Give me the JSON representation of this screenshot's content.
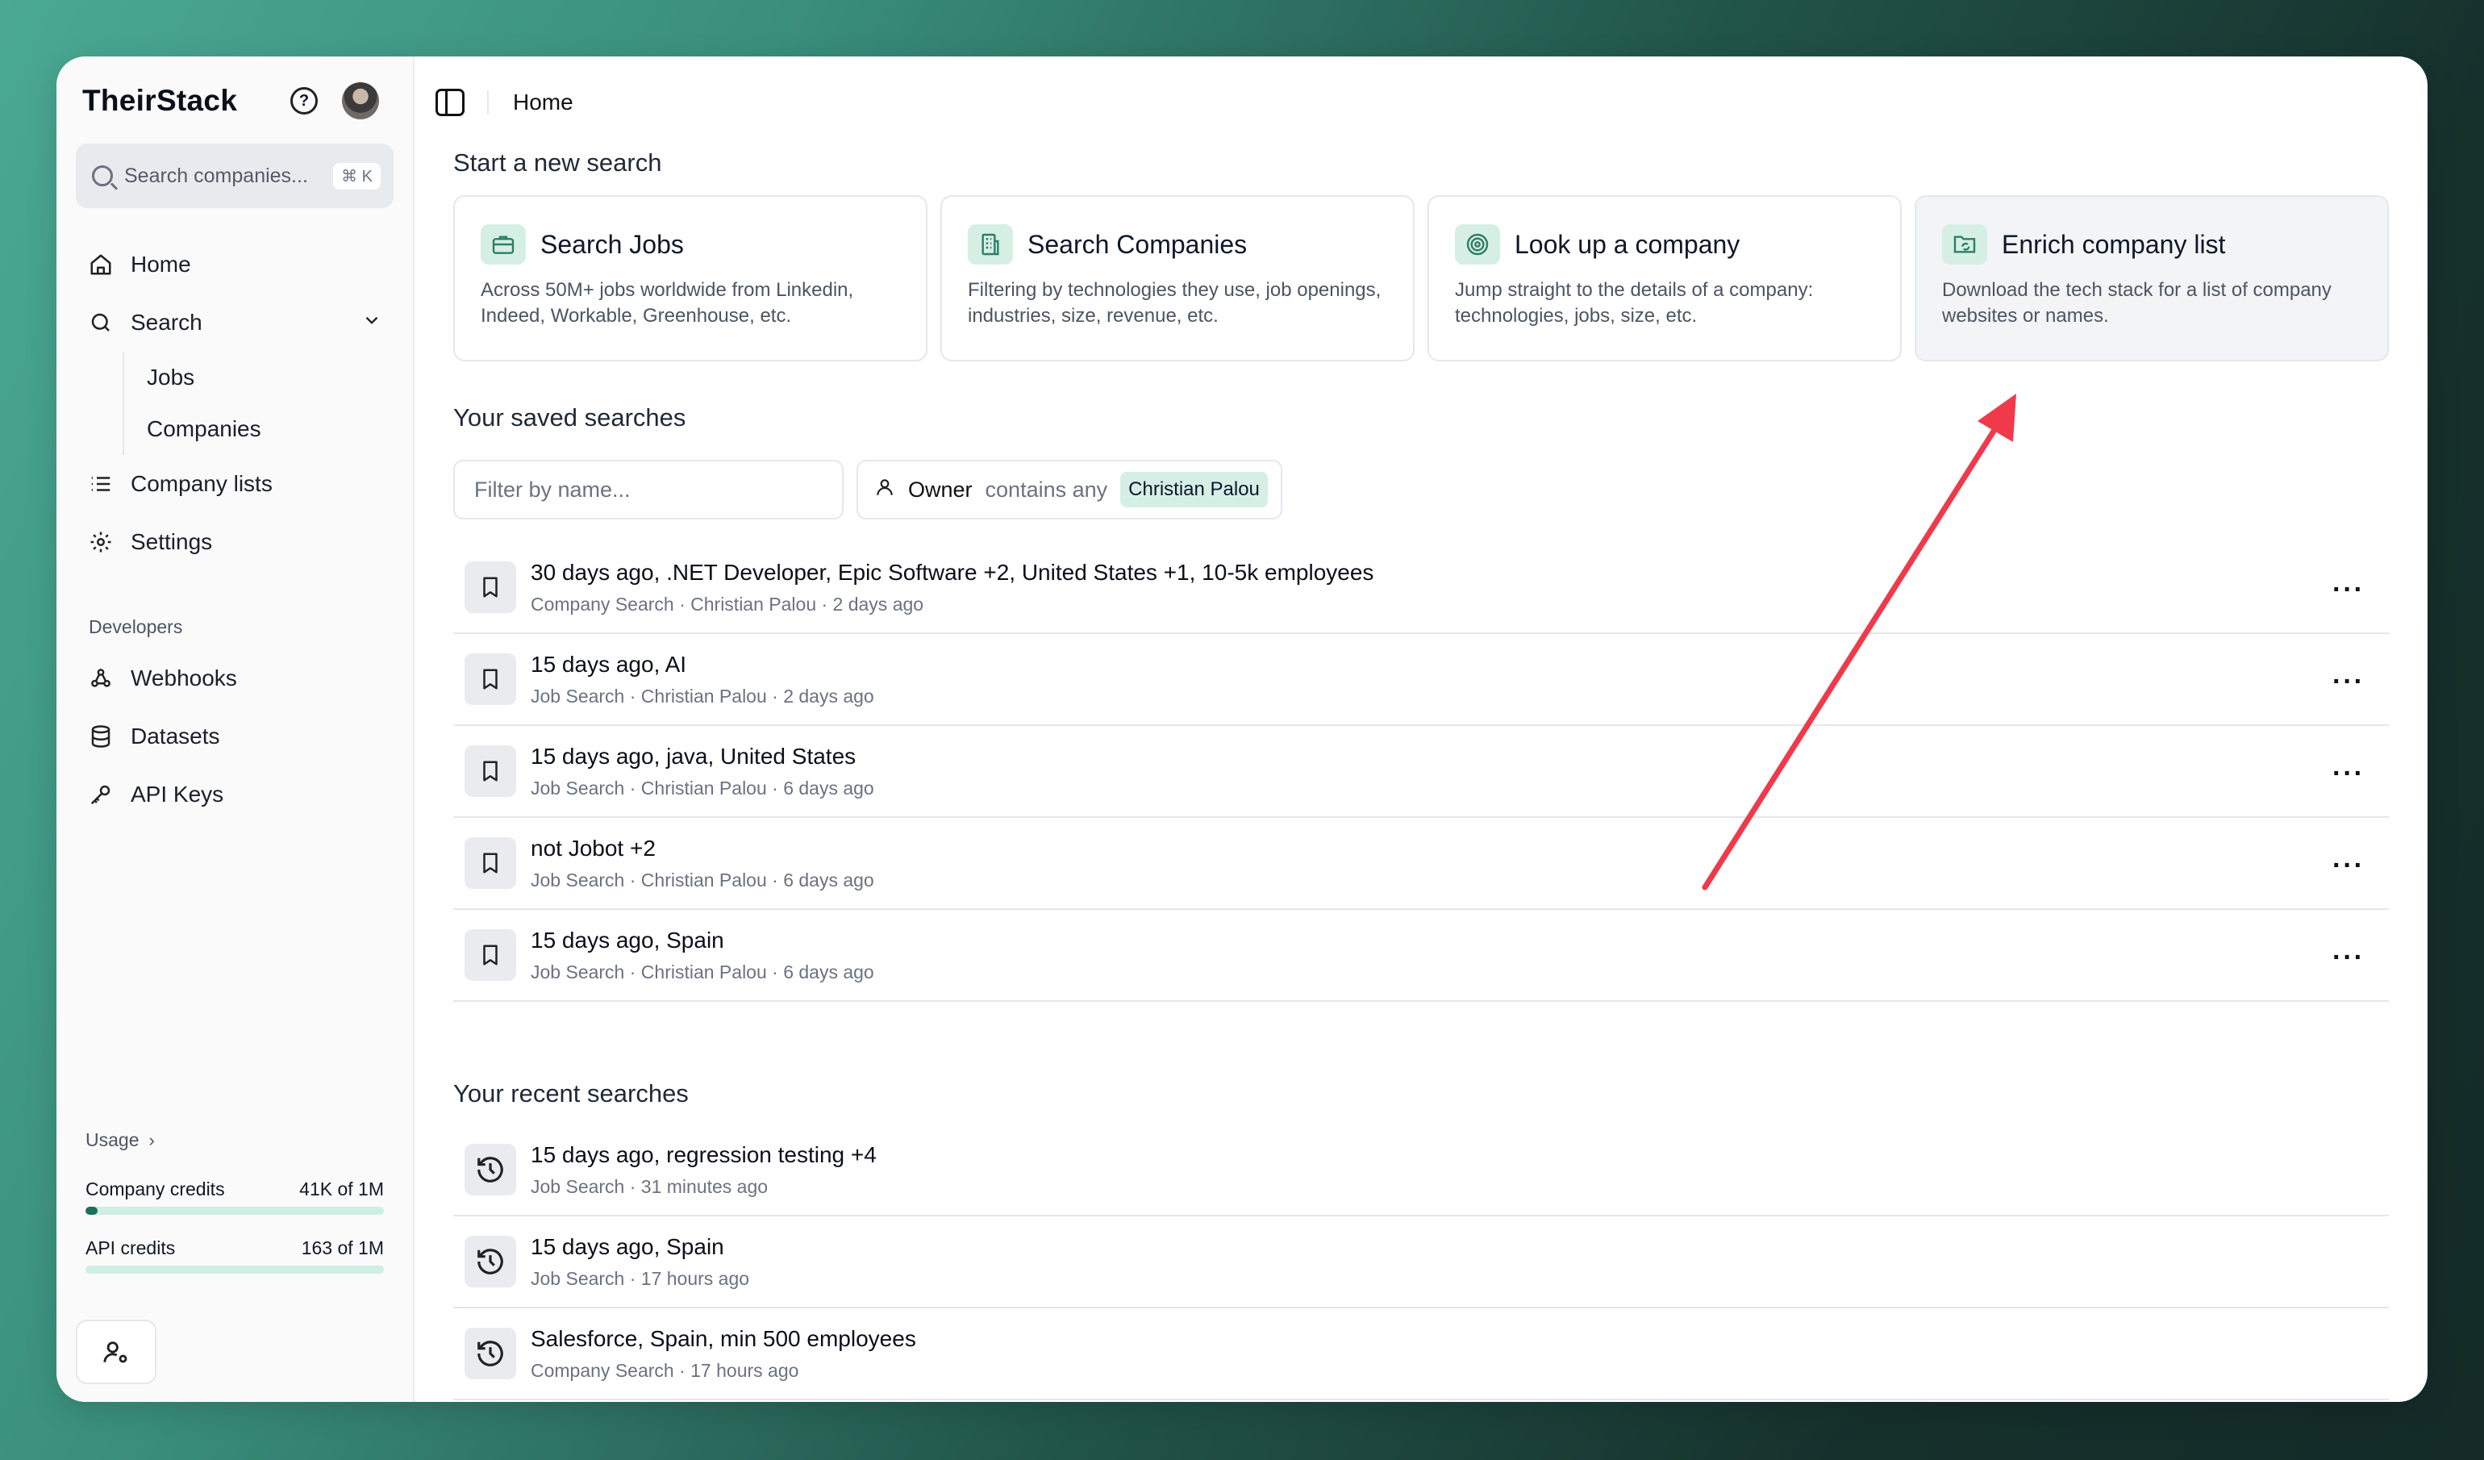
{
  "sidebar": {
    "brand": "TheirStack",
    "search_placeholder": "Search companies...",
    "search_shortcut": "⌘ K",
    "nav": {
      "home": "Home",
      "search": "Search",
      "jobs": "Jobs",
      "companies": "Companies",
      "company_lists": "Company lists",
      "settings": "Settings"
    },
    "developers_label": "Developers",
    "dev_nav": {
      "webhooks": "Webhooks",
      "datasets": "Datasets",
      "api_keys": "API Keys"
    },
    "usage": {
      "title": "Usage",
      "company_credits_label": "Company credits",
      "company_credits_value": "41K of 1M",
      "company_credits_fraction": 0.041,
      "api_credits_label": "API credits",
      "api_credits_value": "163 of 1M",
      "api_credits_fraction": 0.000163
    }
  },
  "topbar": {
    "breadcrumb": "Home"
  },
  "start": {
    "title": "Start a new search",
    "cards": [
      {
        "title": "Search Jobs",
        "desc": "Across 50M+ jobs worldwide from Linkedin, Indeed, Workable, Greenhouse, etc.",
        "icon": "briefcase-icon"
      },
      {
        "title": "Search Companies",
        "desc": "Filtering by technologies they use, job openings, industries, size, revenue, etc.",
        "icon": "building-icon"
      },
      {
        "title": "Look up a company",
        "desc": "Jump straight to the details of a company: technologies, jobs, size, etc.",
        "icon": "target-icon"
      },
      {
        "title": "Enrich company list",
        "desc": "Download the tech stack for a list of company websites or names.",
        "icon": "folder-sync-icon"
      }
    ]
  },
  "saved": {
    "title": "Your saved searches",
    "filter_placeholder": "Filter by name...",
    "owner_label": "Owner",
    "owner_op": "contains any",
    "owner_value": "Christian Palou",
    "items": [
      {
        "title": "30 days ago, .NET Developer, Epic Software +2, United States +1, 10-5k employees",
        "sub": "Company Search · Christian Palou · 2 days ago"
      },
      {
        "title": "15 days ago, AI",
        "sub": "Job Search · Christian Palou · 2 days ago"
      },
      {
        "title": "15 days ago, java, United States",
        "sub": "Job Search · Christian Palou · 6 days ago"
      },
      {
        "title": "not Jobot +2",
        "sub": "Job Search · Christian Palou · 6 days ago"
      },
      {
        "title": "15 days ago, Spain",
        "sub": "Job Search · Christian Palou · 6 days ago"
      }
    ],
    "more_label": "···"
  },
  "recent": {
    "title": "Your recent searches",
    "items": [
      {
        "title": "15 days ago, regression testing +4",
        "sub": "Job Search · 31 minutes ago"
      },
      {
        "title": "15 days ago, Spain",
        "sub": "Job Search · 17 hours ago"
      },
      {
        "title": "Salesforce, Spain, min 500 employees",
        "sub": "Company Search · 17 hours ago"
      }
    ]
  },
  "colors": {
    "accent": "#1b6f5b",
    "accent_soft": "#d6efe5",
    "annotation_arrow": "#f0394b"
  }
}
